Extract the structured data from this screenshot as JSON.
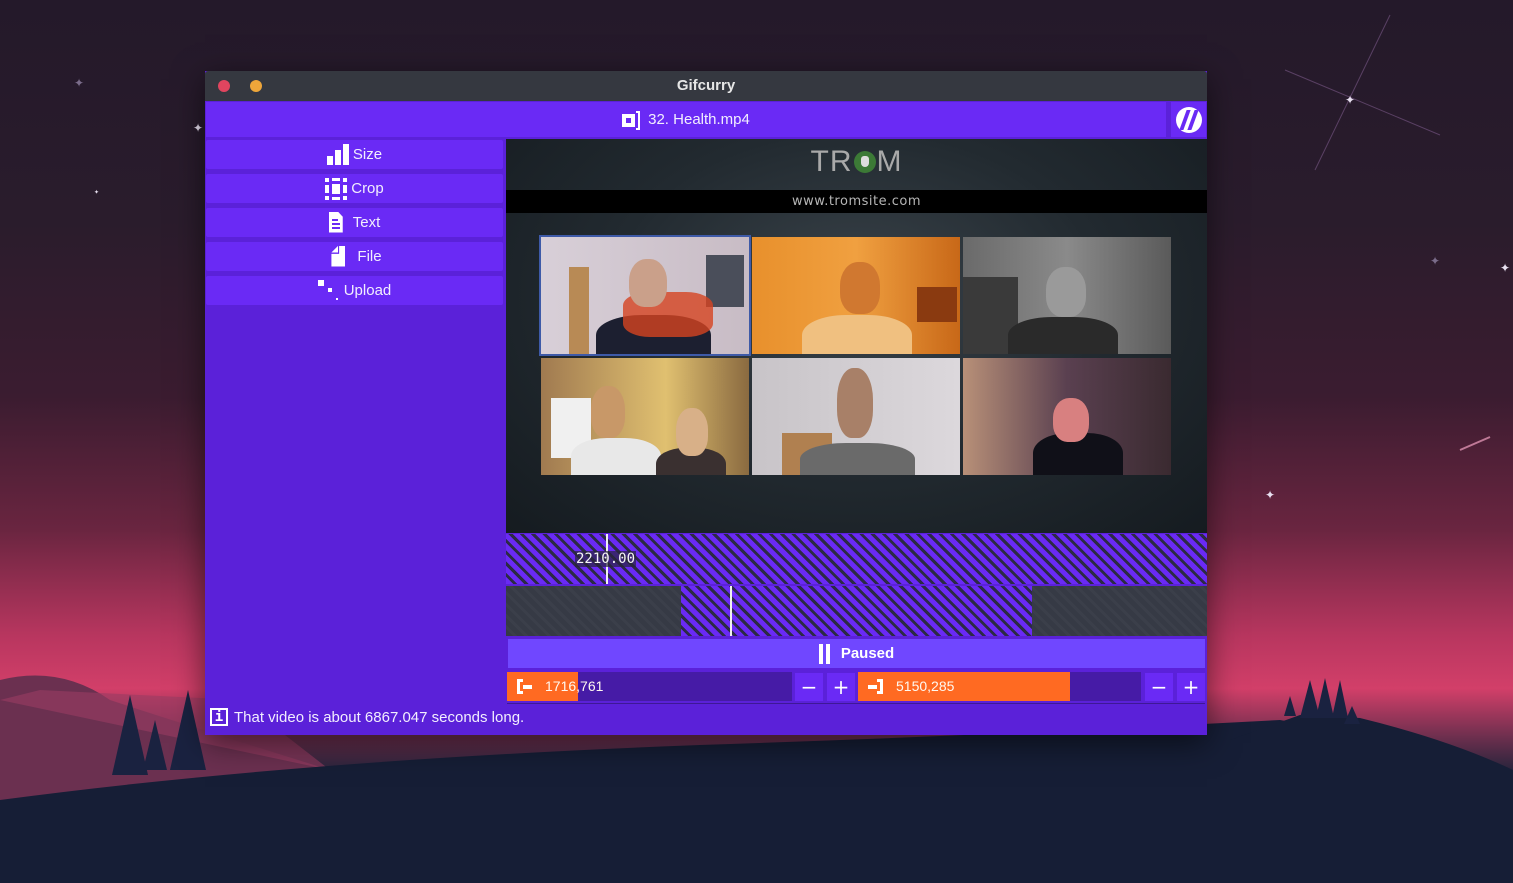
{
  "window": {
    "title": "Gifcurry",
    "controls": [
      "close",
      "minimize"
    ]
  },
  "file": {
    "icon": "video-file-icon",
    "name": "32. Health.mp4"
  },
  "logo": {
    "icon": "gifcurry-logo-icon"
  },
  "sidebar": {
    "items": [
      {
        "label": "Size",
        "icon": "bar-chart-icon"
      },
      {
        "label": "Crop",
        "icon": "crop-icon"
      },
      {
        "label": "Text",
        "icon": "text-document-icon"
      },
      {
        "label": "File",
        "icon": "file-icon"
      },
      {
        "label": "Upload",
        "icon": "upload-icon"
      }
    ]
  },
  "video_preview": {
    "logo_text_left": "TR",
    "logo_text_right": "M",
    "url": "www.tromsite.com",
    "participants_count": 6
  },
  "timeline": {
    "playhead_time": "2210.00",
    "playhead_fraction": 0.143,
    "selection_start_fraction": 0.25,
    "selection_end_fraction": 0.75,
    "cursor_fraction": 0.32
  },
  "playback": {
    "state_label": "Paused",
    "icon": "pause-icon"
  },
  "range": {
    "start_value": "1716,761",
    "start_fill_fraction": 0.25,
    "end_value": "5150,285",
    "end_fill_fraction": 0.75,
    "minus_label": "−",
    "plus_label": "+"
  },
  "status": {
    "icon": "info-icon",
    "message": "That video is about 6867.047 seconds long."
  },
  "colors": {
    "accent": "#6a2af5",
    "panel": "#5b21d9",
    "titlebar": "#353840",
    "range_fill": "#ff6a22",
    "pause_button": "#7047ff"
  }
}
